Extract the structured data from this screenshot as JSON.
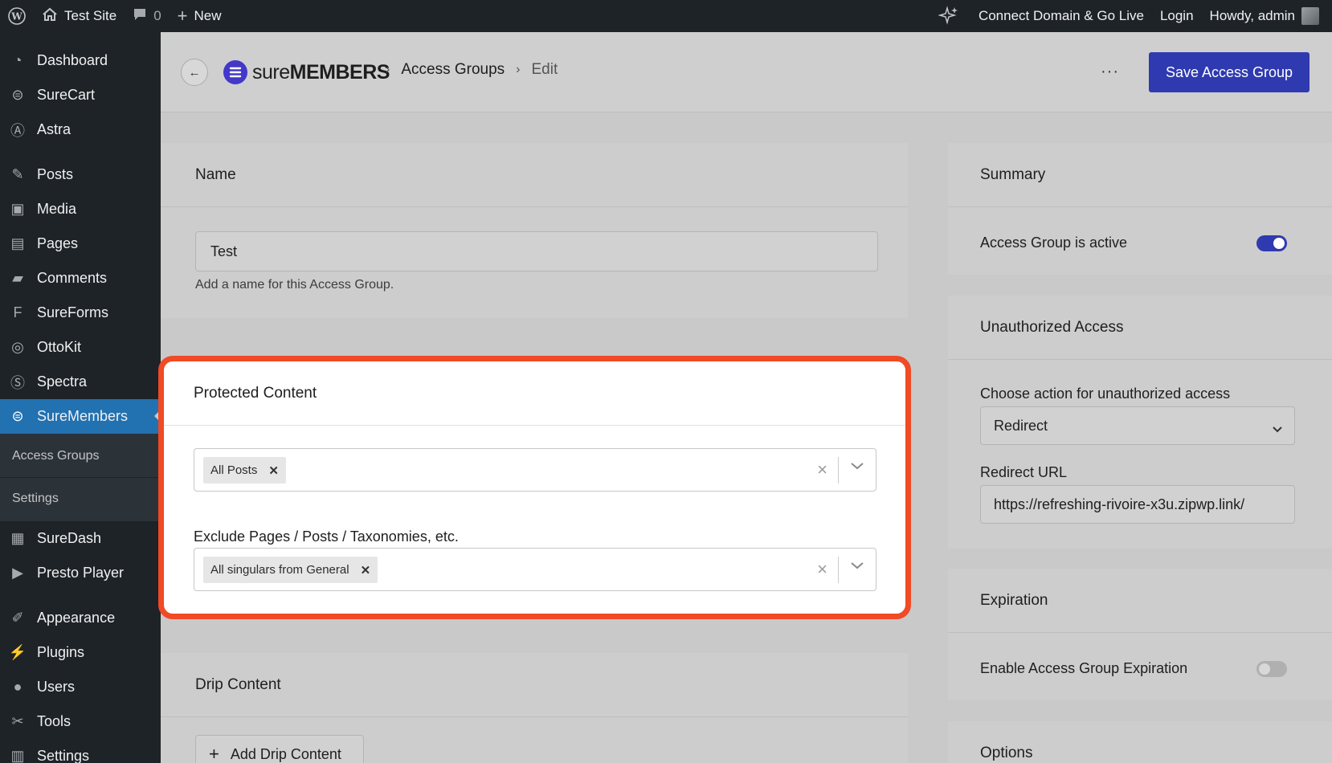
{
  "adminbar": {
    "site_name": "Test Site",
    "comments_count": "0",
    "new_label": "New",
    "connect_label": "Connect Domain & Go Live",
    "login_label": "Login",
    "howdy_label": "Howdy, admin"
  },
  "sidebar": {
    "items": [
      {
        "label": "Dashboard",
        "icon": "dashboard-icon"
      },
      {
        "label": "SureCart",
        "icon": "surecart-icon"
      },
      {
        "label": "Astra",
        "icon": "astra-icon"
      },
      {
        "label": "Posts",
        "icon": "pin-icon"
      },
      {
        "label": "Media",
        "icon": "media-icon"
      },
      {
        "label": "Pages",
        "icon": "pages-icon"
      },
      {
        "label": "Comments",
        "icon": "comment-icon"
      },
      {
        "label": "SureForms",
        "icon": "sureforms-icon"
      },
      {
        "label": "OttoKit",
        "icon": "ottokit-icon"
      },
      {
        "label": "Spectra",
        "icon": "spectra-icon"
      },
      {
        "label": "SureMembers",
        "icon": "suremembers-icon"
      },
      {
        "label": "SureDash",
        "icon": "suredash-icon"
      },
      {
        "label": "Presto Player",
        "icon": "play-icon"
      },
      {
        "label": "Appearance",
        "icon": "brush-icon"
      },
      {
        "label": "Plugins",
        "icon": "plug-icon"
      },
      {
        "label": "Users",
        "icon": "user-icon"
      },
      {
        "label": "Tools",
        "icon": "wrench-icon"
      },
      {
        "label": "Settings",
        "icon": "settings-icon"
      }
    ],
    "submenu": {
      "access_groups": "Access Groups",
      "settings": "Settings"
    }
  },
  "header": {
    "logo_light": "sure",
    "logo_bold": "MEMBERS",
    "crumb_1": "Access Groups",
    "crumb_2": "Edit",
    "more": "···",
    "save_label": "Save Access Group"
  },
  "name_card": {
    "title": "Name",
    "value": "Test",
    "help": "Add a name for this Access Group."
  },
  "protected_card": {
    "title": "Protected Content",
    "include_chip": "All Posts",
    "exclude_label": "Exclude Pages / Posts / Taxonomies, etc.",
    "exclude_chip": "All singulars from General"
  },
  "drip_card": {
    "title": "Drip Content",
    "add_label": "Add Drip Content"
  },
  "summary_card": {
    "title": "Summary",
    "active_label": "Access Group is active",
    "active": true
  },
  "unauth_card": {
    "title": "Unauthorized Access",
    "action_label": "Choose action for unauthorized access",
    "action_value": "Redirect",
    "redirect_label": "Redirect URL",
    "redirect_value": "https://refreshing-rivoire-x3u.zipwp.link/"
  },
  "expiration_card": {
    "title": "Expiration",
    "enable_label": "Enable Access Group Expiration",
    "enabled": false
  },
  "options_card": {
    "title": "Options"
  },
  "colors": {
    "highlight": "#f04a26",
    "brand": "#2f3ab0",
    "wp_admin": "#1d2327",
    "menu_active": "#2271b1"
  }
}
